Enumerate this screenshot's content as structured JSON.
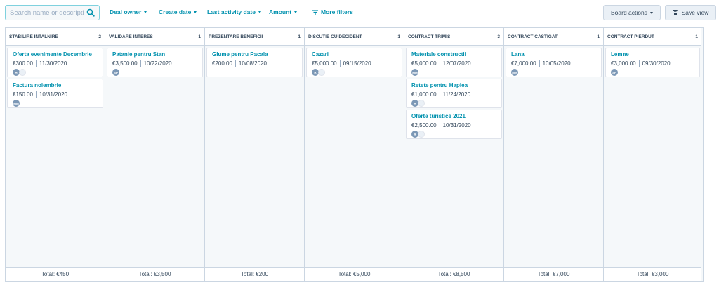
{
  "search": {
    "placeholder": "Search name or description",
    "value": ""
  },
  "filters": [
    {
      "label": "Deal owner"
    },
    {
      "label": "Create date"
    },
    {
      "label": "Last activity date"
    },
    {
      "label": "Amount"
    },
    {
      "label": "More filters"
    }
  ],
  "buttons": {
    "board_actions": "Board actions",
    "save_view": "Save view"
  },
  "colors": {
    "accent": "#0091ae",
    "avatar": "#7c98b6",
    "board_bg": "#f5f8fa",
    "border": "#cbd6e2"
  },
  "icons": {
    "search": "search-icon",
    "more_filters": "filter-lines-icon",
    "save": "floppy-disk-icon"
  },
  "columns": [
    {
      "title": "STABILIRE INTALNIRE",
      "count": "2",
      "total": "Total: €450",
      "cards": [
        {
          "name": "Oferta evenimente Decembrie",
          "amount": "€300.00",
          "date": "11/30/2020",
          "avatar": "H",
          "extra_avatar": true
        },
        {
          "name": "Factura noiembrie",
          "amount": "€150.00",
          "date": "10/31/2020",
          "avatar": "MM",
          "extra_avatar": false
        }
      ]
    },
    {
      "title": "VALIDARE INTERES",
      "count": "1",
      "total": "Total: €3,500",
      "cards": [
        {
          "name": "Patanie pentru Stan",
          "amount": "€3,500.00",
          "date": "10/22/2020",
          "avatar": "SP",
          "extra_avatar": false
        }
      ]
    },
    {
      "title": "PREZENTARE BENEFICII",
      "count": "1",
      "total": "Total: €200",
      "cards": [
        {
          "name": "Glume pentru Pacala",
          "amount": "€200.00",
          "date": "10/08/2020",
          "avatar": "",
          "extra_avatar": false
        }
      ]
    },
    {
      "title": "DISCUTIE CU DECIDENT",
      "count": "1",
      "total": "Total: €5,000",
      "cards": [
        {
          "name": "Cazari",
          "amount": "€5,000.00",
          "date": "09/15/2020",
          "avatar": "R",
          "extra_avatar": true
        }
      ]
    },
    {
      "title": "CONTRACT TRIMIS",
      "count": "3",
      "total": "Total: €8,500",
      "cards": [
        {
          "name": "Materiale constructii",
          "amount": "€5,000.00",
          "date": "12/07/2020",
          "avatar": "MM",
          "extra_avatar": false
        },
        {
          "name": "Retete pentru Haplea",
          "amount": "€1,000.00",
          "date": "11/24/2020",
          "avatar": "H",
          "extra_avatar": true
        },
        {
          "name": "Oferte turistice 2021",
          "amount": "€2,500.00",
          "date": "10/31/2020",
          "avatar": "R",
          "extra_avatar": true
        }
      ]
    },
    {
      "title": "CONTRACT CASTIGAT",
      "count": "1",
      "total": "Total: €7,000",
      "cards": [
        {
          "name": "Lana",
          "amount": "€7,000.00",
          "date": "10/05/2020",
          "avatar": "MM",
          "extra_avatar": false
        }
      ]
    },
    {
      "title": "CONTRACT PIERDUT",
      "count": "1",
      "total": "Total: €3,000",
      "cards": [
        {
          "name": "Lemne",
          "amount": "€3,000.00",
          "date": "09/30/2020",
          "avatar": "SP",
          "extra_avatar": false
        }
      ]
    }
  ]
}
